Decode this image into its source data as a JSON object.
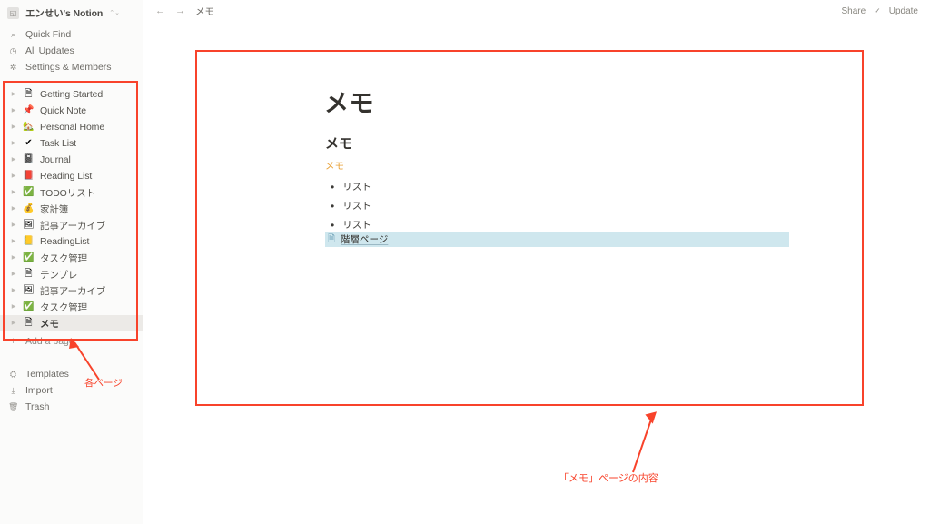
{
  "sidebar": {
    "workspace": {
      "name": "エンせい's Notion",
      "avatar_glyph": "◱",
      "chevron": "⌃⌄"
    },
    "nav": [
      {
        "label": "Quick Find",
        "icon": "search-icon",
        "glyph": "⌕"
      },
      {
        "label": "All Updates",
        "icon": "clock-icon",
        "glyph": "◷"
      },
      {
        "label": "Settings & Members",
        "icon": "gear-icon",
        "glyph": "✲"
      }
    ],
    "pages": [
      {
        "label": "Getting Started",
        "icon": "page-icon",
        "glyph": "🗎",
        "selected": false
      },
      {
        "label": "Quick Note",
        "icon": "pushpin-icon",
        "glyph": "📌",
        "selected": false
      },
      {
        "label": "Personal Home",
        "icon": "house-icon",
        "glyph": "🏡",
        "selected": false
      },
      {
        "label": "Task List",
        "icon": "checkmark-icon",
        "glyph": "✔",
        "selected": false
      },
      {
        "label": "Journal",
        "icon": "notebook-icon",
        "glyph": "📓",
        "selected": false
      },
      {
        "label": "Reading List",
        "icon": "book-icon",
        "glyph": "📕",
        "selected": false
      },
      {
        "label": "TODOリスト",
        "icon": "green-check-icon",
        "glyph": "✅",
        "selected": false
      },
      {
        "label": "家計簿",
        "icon": "money-bag-icon",
        "glyph": "💰",
        "selected": false
      },
      {
        "label": "記事アーカイブ",
        "icon": "framed-picture-icon",
        "glyph": "🖼",
        "selected": false
      },
      {
        "label": "ReadingList",
        "icon": "folder-icon",
        "glyph": "📒",
        "selected": false
      },
      {
        "label": "タスク管理",
        "icon": "green-check-icon",
        "glyph": "✅",
        "selected": false
      },
      {
        "label": "テンプレ",
        "icon": "page-icon",
        "glyph": "🗎",
        "selected": false
      },
      {
        "label": "記事アーカイブ",
        "icon": "framed-picture-icon",
        "glyph": "🖼",
        "selected": false
      },
      {
        "label": "タスク管理",
        "icon": "green-check-icon",
        "glyph": "✅",
        "selected": false
      },
      {
        "label": "メモ",
        "icon": "page-icon",
        "glyph": "🗎",
        "selected": true
      }
    ],
    "add_page": {
      "label": "Add a page",
      "glyph": "+"
    },
    "bottom": [
      {
        "label": "Templates",
        "icon": "templates-icon",
        "glyph": "⛭"
      },
      {
        "label": "Import",
        "icon": "import-icon",
        "glyph": "⤓"
      },
      {
        "label": "Trash",
        "icon": "trash-icon",
        "glyph": "🗑"
      }
    ],
    "annotation": "各ページ"
  },
  "topbar": {
    "back_glyph": "←",
    "forward_glyph": "→",
    "breadcrumb": "メモ",
    "share_label": "Share",
    "check_glyph": "✓",
    "update_label": "Update"
  },
  "content": {
    "title": "メモ",
    "heading": "メモ",
    "orange_text": "メモ",
    "bullets": [
      {
        "dot": "•",
        "text": "リスト"
      },
      {
        "dot": "•",
        "text": "リスト"
      },
      {
        "dot": "•",
        "text": "リスト"
      }
    ],
    "link_block": {
      "icon": "page-icon",
      "glyph": "🗎",
      "text": "階層ページ"
    },
    "annotation": "「メモ」ページの内容"
  },
  "colors": {
    "annotation_red": "#f8432b",
    "orange_text": "#e9a33b",
    "link_highlight": "#cfe7ee",
    "sidebar_bg": "#fbfbfa"
  }
}
